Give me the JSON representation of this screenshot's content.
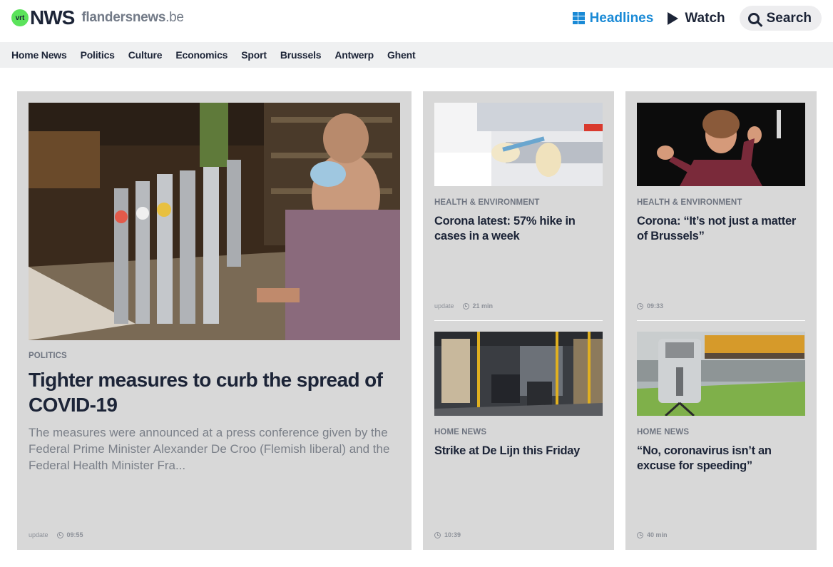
{
  "brand": {
    "badge": "vrt",
    "name": "NWS",
    "site_name": "flandersnews",
    "site_tld": ".be"
  },
  "topnav": {
    "headlines": "Headlines",
    "watch": "Watch",
    "search": "Search"
  },
  "subnav": [
    "Home News",
    "Politics",
    "Culture",
    "Economics",
    "Sport",
    "Brussels",
    "Antwerp",
    "Ghent"
  ],
  "colors": {
    "accent": "#1a8ad6",
    "logo_green": "#5be35b",
    "text_dark": "#1c2437",
    "card_bg": "#d8d8d8",
    "subnav_bg": "#eff0f1"
  },
  "main_article": {
    "image_icon": "bartender-photo",
    "category": "POLITICS",
    "title": "Tighter measures to curb the spread of COVID-19",
    "summary": "The measures were announced at a press conference given by the Federal Prime Minister Alexander De Croo (Flemish liberal) and the Federal Health Minister Fra...",
    "update_label": "update",
    "time": "09:55"
  },
  "articles": [
    {
      "image_icon": "lab-test-photo",
      "category": "HEALTH & ENVIRONMENT",
      "title": "Corona latest: 57% hike in cases in a week",
      "update_label": "update",
      "time": "21 min"
    },
    {
      "image_icon": "minister-speaking-photo",
      "category": "HEALTH & ENVIRONMENT",
      "title": "Corona: “It’s not just a matter of Brussels”",
      "update_label": "",
      "time": "09:33"
    },
    {
      "image_icon": "bus-interior-photo",
      "category": "HOME NEWS",
      "title": "Strike at De Lijn this Friday",
      "update_label": "",
      "time": "10:39"
    },
    {
      "image_icon": "speed-camera-photo",
      "category": "HOME NEWS",
      "title": "“No, coronavirus isn’t an excuse for speeding”",
      "update_label": "",
      "time": "40 min"
    }
  ]
}
